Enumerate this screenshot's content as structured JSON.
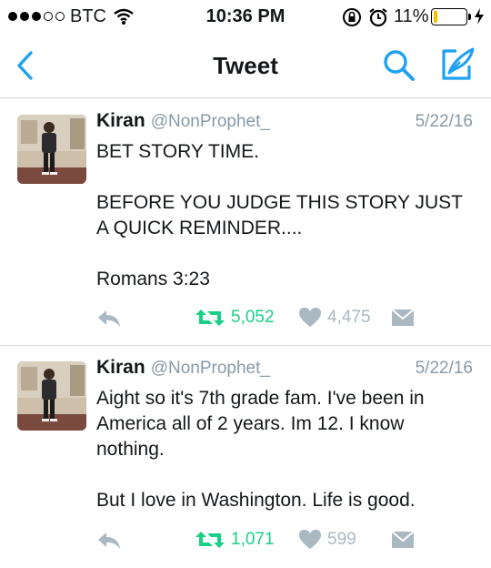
{
  "status_bar": {
    "carrier": "BTC",
    "time": "10:36 PM",
    "battery_percent": "11%",
    "battery_level": 0.11,
    "battery_color": "#f2c200"
  },
  "nav": {
    "title": "Tweet",
    "back_icon": "chevron-left-icon",
    "search_icon": "search-icon",
    "compose_icon": "compose-icon",
    "accent_color": "#1da1f2"
  },
  "tweets": [
    {
      "author_name": "Kiran",
      "author_handle": "@NonProphet_",
      "date": "5/22/16",
      "lines": [
        "BET STORY TIME.",
        "",
        "BEFORE YOU JUDGE THIS STORY JUST",
        "A QUICK REMINDER....",
        "",
        "Romans 3:23"
      ],
      "retweets": "5,052",
      "likes": "4,475"
    },
    {
      "author_name": "Kiran",
      "author_handle": "@NonProphet_",
      "date": "5/22/16",
      "lines": [
        "Aight so it's 7th grade fam. I've been in",
        "America all of 2 years. Im 12. I know",
        "nothing.",
        "",
        "But I love in Washington. Life is good."
      ],
      "retweets": "1,071",
      "likes": "599"
    }
  ],
  "colors": {
    "retweet_green": "#19cf86",
    "muted_gray": "#aab8c2"
  }
}
